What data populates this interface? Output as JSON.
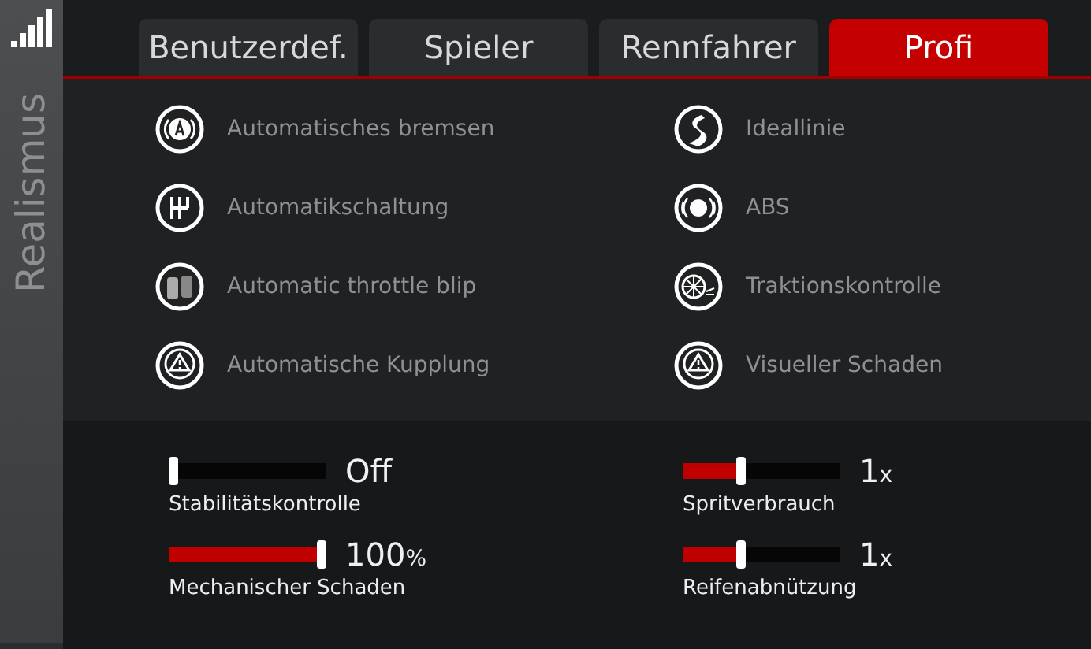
{
  "sidebar": {
    "title": "Realismus"
  },
  "tabs": [
    {
      "label": "Benutzerdef.",
      "selected": false
    },
    {
      "label": "Spieler",
      "selected": false
    },
    {
      "label": "Rennfahrer",
      "selected": false
    },
    {
      "label": "Profi",
      "selected": true
    }
  ],
  "assists": [
    {
      "label": "Automatisches bremsen"
    },
    {
      "label": "Ideallinie"
    },
    {
      "label": "Automatikschaltung"
    },
    {
      "label": "ABS"
    },
    {
      "label": "Automatic throttle blip"
    },
    {
      "label": "Traktionskontrolle"
    },
    {
      "label": "Automatische Kupplung"
    },
    {
      "label": "Visueller Schaden"
    }
  ],
  "sliders": [
    {
      "label": "Stabilitätskontrolle",
      "level": 0,
      "reading": "Off"
    },
    {
      "label": "Spritverbrauch",
      "level": 0.36,
      "reading": "1",
      "unit": "x"
    },
    {
      "label": "Mechanischer Schaden",
      "level": 1,
      "reading": "100",
      "unit": "%"
    },
    {
      "label": "Reifenabnützung",
      "level": 0.36,
      "reading": "1",
      "unit": "x"
    }
  ]
}
